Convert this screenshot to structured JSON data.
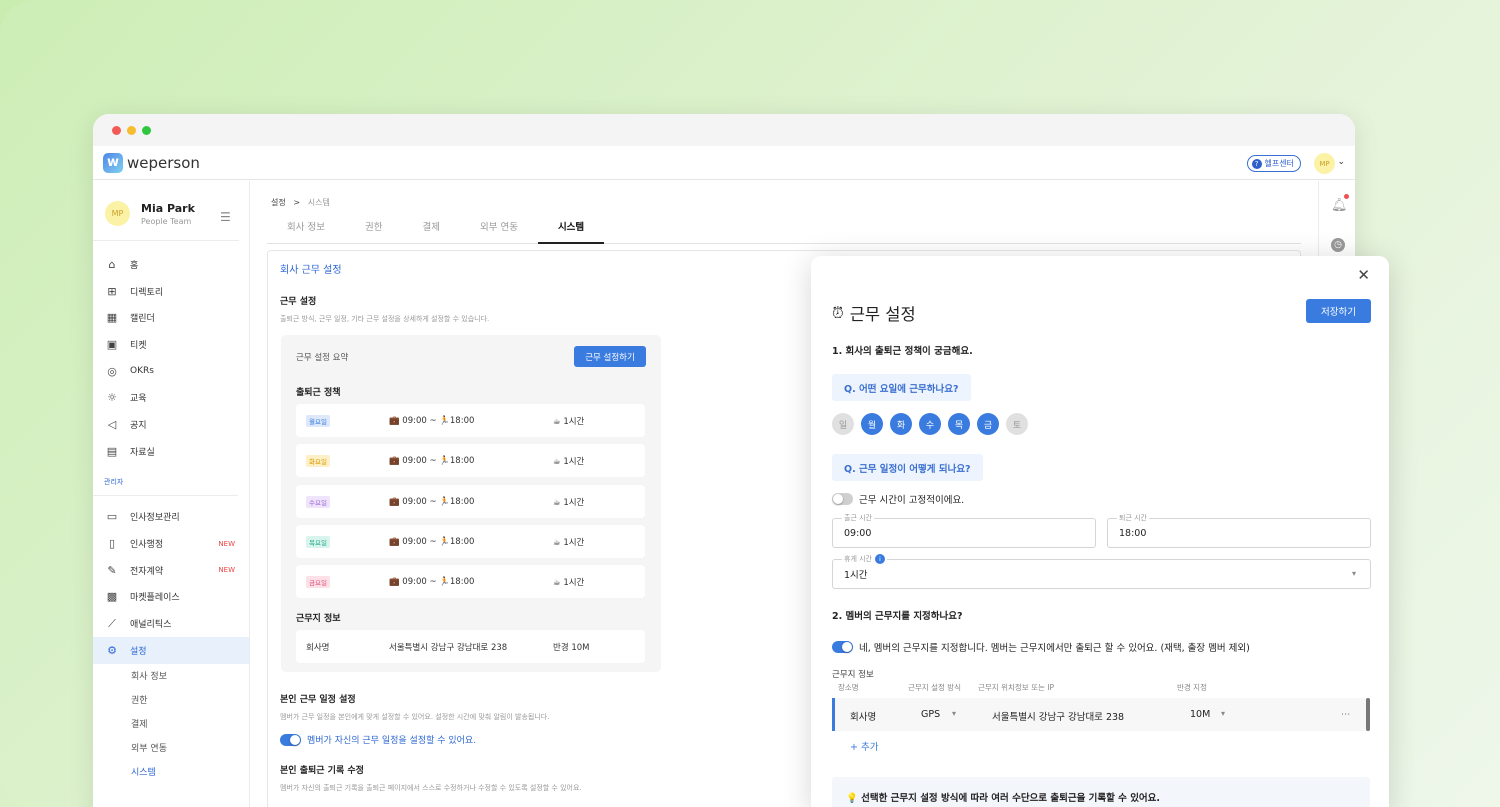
{
  "app": {
    "logo_mark": "w",
    "logo_text": "weperson",
    "help_label": "헬프센터",
    "user_initials": "MP"
  },
  "colors": {
    "accent": "#3a7be0",
    "brand": "#2e67d4",
    "new_badge": "#e44444",
    "bg_gradient": "#cdeeb6"
  },
  "profile": {
    "name": "Mia Park",
    "team": "People Team",
    "initials": "MP"
  },
  "nav": {
    "items": [
      {
        "label": "홈",
        "icon": "home-icon",
        "glyph": "⌂"
      },
      {
        "label": "디렉토리",
        "icon": "org-chart-icon",
        "glyph": "⊞"
      },
      {
        "label": "캘린더",
        "icon": "calendar-icon",
        "glyph": "▦"
      },
      {
        "label": "티켓",
        "icon": "ticket-icon",
        "glyph": "▣"
      },
      {
        "label": "OKRs",
        "icon": "target-icon",
        "glyph": "◎"
      },
      {
        "label": "교육",
        "icon": "lightbulb-icon",
        "glyph": "☼"
      },
      {
        "label": "공지",
        "icon": "megaphone-icon",
        "glyph": "◁"
      },
      {
        "label": "자료실",
        "icon": "archive-icon",
        "glyph": "▤"
      }
    ],
    "admin_label": "관리자",
    "admin_items": [
      {
        "label": "인사정보관리",
        "icon": "id-card-icon",
        "glyph": "▭",
        "badge": ""
      },
      {
        "label": "인사행정",
        "icon": "document-icon",
        "glyph": "▯",
        "badge": "NEW"
      },
      {
        "label": "전자계약",
        "icon": "contract-icon",
        "glyph": "✎",
        "badge": "NEW"
      },
      {
        "label": "마켓플레이스",
        "icon": "gift-icon",
        "glyph": "▩",
        "badge": ""
      },
      {
        "label": "애널리틱스",
        "icon": "chart-line-icon",
        "glyph": "⟋",
        "badge": ""
      },
      {
        "label": "설정",
        "icon": "gear-icon",
        "glyph": "⚙",
        "badge": ""
      }
    ],
    "settings_sub": [
      "회사 정보",
      "권한",
      "결제",
      "외부 연동",
      "시스템"
    ]
  },
  "main": {
    "breadcrumb_root": "설정",
    "breadcrumb_sep": ">",
    "breadcrumb_current": "시스템",
    "tabs": [
      "회사 정보",
      "권한",
      "결제",
      "외부 연동",
      "시스템"
    ],
    "card_title": "회사 근무 설정",
    "work_h": "근무 설정",
    "work_d": "출퇴근 방식, 근무 일정, 기타 근무 설정을 상세하게 설정할 수 있습니다.",
    "summary_title": "근무 설정 요약",
    "summary_button": "근무 설정하기",
    "policy_h": "출퇴근 정책",
    "rows": [
      {
        "day": "월요일",
        "time": "💼 09:00 ~ 🏃18:00",
        "break": "☕ 1시간",
        "color": "#3a7be0",
        "bg": "#dde9fb"
      },
      {
        "day": "화요일",
        "time": "💼 09:00 ~ 🏃18:00",
        "break": "☕ 1시간",
        "color": "#d89a00",
        "bg": "#fdf0c6"
      },
      {
        "day": "수요일",
        "time": "💼 09:00 ~ 🏃18:00",
        "break": "☕ 1시간",
        "color": "#9a68d8",
        "bg": "#efe4fb"
      },
      {
        "day": "목요일",
        "time": "💼 09:00 ~ 🏃18:00",
        "break": "☕ 1시간",
        "color": "#1fa889",
        "bg": "#d8f4ec"
      },
      {
        "day": "금요일",
        "time": "💼 09:00 ~ 🏃18:00",
        "break": "☕ 1시간",
        "color": "#e0547a",
        "bg": "#fde0e8"
      }
    ],
    "location_h": "근무지 정보",
    "location": {
      "name": "회사명",
      "address": "서울특별시 강남구 강남대로 238",
      "radius": "반경 10M"
    },
    "own_h": "본인 근무 일정 설정",
    "own_d": "멤버가 근무 일정을 본인에게 맞게 설정할 수 있어요. 설정한 시간에 맞춰 알림이 발송됩니다.",
    "own_toggle": "멤버가 자신의 근무 일정을 설정할 수 있어요.",
    "record_h": "본인 출퇴근 기록 수정",
    "record_d": "멤버가 자신의 출퇴근 기록을 출퇴근 페이지에서 스스로 수정하거나 수정할 수 있도록 설정할 수 있어요."
  },
  "modal": {
    "close": "✕",
    "title": "근무 설정",
    "save": "저장하기",
    "q1_h": "1. 회사의 출퇴근 정책이 궁금해요.",
    "q_days": "Q. 어떤 요일에 근무하나요?",
    "days": [
      "일",
      "월",
      "화",
      "수",
      "목",
      "금",
      "토"
    ],
    "q_schedule": "Q. 근무 일정이 어떻게 되나요?",
    "fixed_toggle": "근무 시간이 고정적이에요.",
    "start_label": "출근 시간",
    "start_value": "09:00",
    "end_label": "퇴근 시간",
    "end_value": "18:00",
    "break_label": "휴게 시간",
    "break_value": "1시간",
    "q2_h": "2. 멤버의 근무지를 지정하나요?",
    "loc_toggle": "네, 멤버의 근무지를 지정합니다. 멤버는 근무지에서만 출퇴근 할 수 있어요. (재택, 출장 멤버 제외)",
    "loc_info": "근무지 정보",
    "cols": [
      "장소명",
      "근무지 설정 방식",
      "근무지 위치정보 또는 IP",
      "반경 지정"
    ],
    "loc_name": "회사명",
    "loc_method": "GPS",
    "loc_address": "서울특별시 강남구 강남대로 238",
    "loc_radius": "10M",
    "add": "+ 추가",
    "tip": "💡 선택한 근무지 설정 방식에 따라 여러 수단으로 출퇴근을 기록할 수 있어요."
  }
}
